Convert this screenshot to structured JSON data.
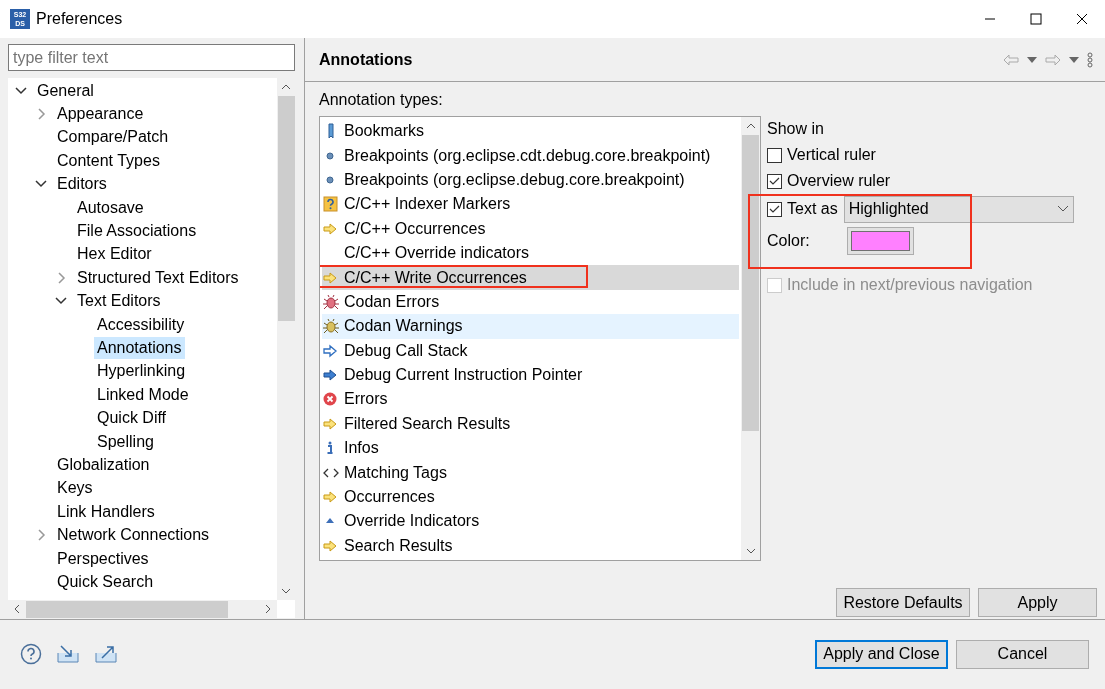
{
  "window": {
    "title": "Preferences",
    "logo_lines": [
      "S32",
      "DS"
    ]
  },
  "filter": {
    "placeholder": "type filter text"
  },
  "tree": [
    {
      "label": "General",
      "expanded": true,
      "selected": false,
      "children": [
        {
          "label": "Appearance",
          "expanded": false,
          "selected": false
        },
        {
          "label": "Compare/Patch",
          "selected": false
        },
        {
          "label": "Content Types",
          "selected": false
        },
        {
          "label": "Editors",
          "expanded": true,
          "selected": false,
          "children": [
            {
              "label": "Autosave",
              "selected": false
            },
            {
              "label": "File Associations",
              "selected": false
            },
            {
              "label": "Hex Editor",
              "selected": false
            },
            {
              "label": "Structured Text Editors",
              "expanded": false,
              "selected": false
            },
            {
              "label": "Text Editors",
              "expanded": true,
              "selected": false,
              "children": [
                {
                  "label": "Accessibility",
                  "selected": false
                },
                {
                  "label": "Annotations",
                  "selected": true
                },
                {
                  "label": "Hyperlinking",
                  "selected": false
                },
                {
                  "label": "Linked Mode",
                  "selected": false
                },
                {
                  "label": "Quick Diff",
                  "selected": false
                },
                {
                  "label": "Spelling",
                  "selected": false
                }
              ]
            }
          ]
        },
        {
          "label": "Globalization",
          "selected": false
        },
        {
          "label": "Keys",
          "selected": false
        },
        {
          "label": "Link Handlers",
          "selected": false
        },
        {
          "label": "Network Connections",
          "expanded": false,
          "selected": false
        },
        {
          "label": "Perspectives",
          "selected": false
        },
        {
          "label": "Quick Search",
          "selected": false
        }
      ]
    }
  ],
  "page": {
    "title": "Annotations",
    "list_label": "Annotation types:"
  },
  "annotation_types": [
    {
      "label": "Bookmarks",
      "kind": "bookmark",
      "selected": false,
      "hovered": false,
      "outlined": false
    },
    {
      "label": "Breakpoints (org.eclipse.cdt.debug.core.breakpoint)",
      "kind": "dot",
      "selected": false,
      "hovered": false,
      "outlined": false
    },
    {
      "label": "Breakpoints (org.eclipse.debug.core.breakpoint)",
      "kind": "dot",
      "selected": false,
      "hovered": false,
      "outlined": false
    },
    {
      "label": "C/C++ Indexer Markers",
      "kind": "question",
      "selected": false,
      "hovered": false,
      "outlined": false
    },
    {
      "label": "C/C++ Occurrences",
      "kind": "arrow-yellow",
      "selected": false,
      "hovered": false,
      "outlined": false
    },
    {
      "label": "C/C++ Override indicators",
      "kind": "none",
      "selected": false,
      "hovered": false,
      "outlined": false
    },
    {
      "label": "C/C++ Write Occurrences",
      "kind": "arrow-yellow",
      "selected": true,
      "hovered": false,
      "outlined": true
    },
    {
      "label": "Codan Errors",
      "kind": "bug-red",
      "selected": false,
      "hovered": false,
      "outlined": false
    },
    {
      "label": "Codan Warnings",
      "kind": "bug-yellow",
      "selected": false,
      "hovered": true,
      "outlined": false
    },
    {
      "label": "Debug Call Stack",
      "kind": "arrow-blue-outline",
      "selected": false,
      "hovered": false,
      "outlined": false
    },
    {
      "label": "Debug Current Instruction Pointer",
      "kind": "arrow-blue",
      "selected": false,
      "hovered": false,
      "outlined": false
    },
    {
      "label": "Errors",
      "kind": "error",
      "selected": false,
      "hovered": false,
      "outlined": false
    },
    {
      "label": "Filtered Search Results",
      "kind": "arrow-yellow",
      "selected": false,
      "hovered": false,
      "outlined": false
    },
    {
      "label": "Infos",
      "kind": "info",
      "selected": false,
      "hovered": false,
      "outlined": false
    },
    {
      "label": "Matching Tags",
      "kind": "tags",
      "selected": false,
      "hovered": false,
      "outlined": false
    },
    {
      "label": "Occurrences",
      "kind": "arrow-yellow",
      "selected": false,
      "hovered": false,
      "outlined": false
    },
    {
      "label": "Override Indicators",
      "kind": "caret",
      "selected": false,
      "hovered": false,
      "outlined": false
    },
    {
      "label": "Search Results",
      "kind": "arrow-yellow",
      "selected": false,
      "hovered": false,
      "outlined": false
    }
  ],
  "options": {
    "show_in_label": "Show in",
    "vertical_ruler": {
      "label": "Vertical ruler",
      "checked": false
    },
    "overview_ruler": {
      "label": "Overview ruler",
      "checked": true
    },
    "text_as": {
      "label": "Text as",
      "checked": true,
      "value": "Highlighted"
    },
    "color_label": "Color:",
    "color": "#ff80ff",
    "outlined": true,
    "include_nav": {
      "label": "Include in next/previous navigation",
      "checked": false,
      "disabled": true
    }
  },
  "page_buttons": [
    "Restore Defaults",
    "Apply"
  ],
  "dialog_buttons": [
    {
      "label": "Apply and Close",
      "default": true
    },
    {
      "label": "Cancel",
      "default": false
    }
  ]
}
